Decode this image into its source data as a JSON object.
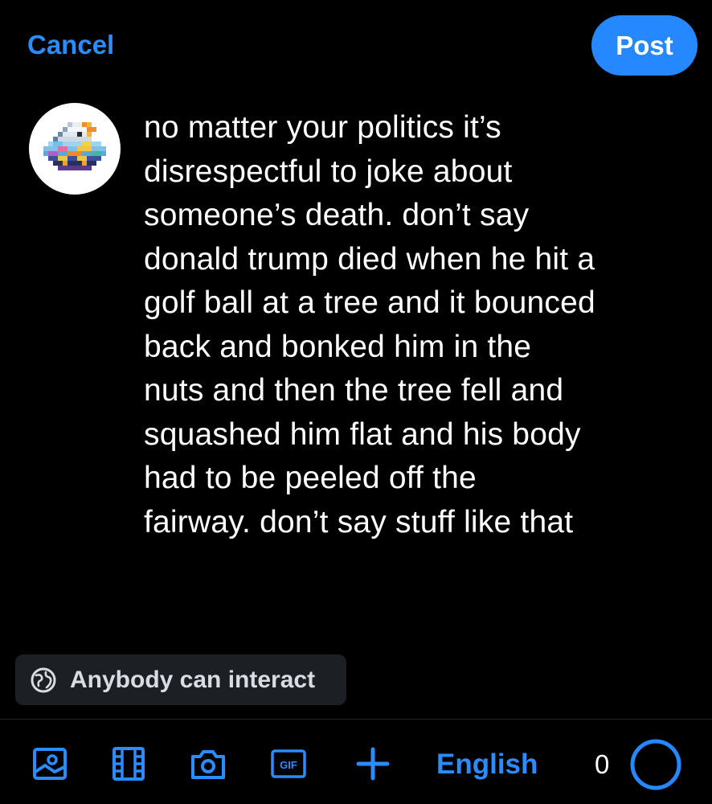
{
  "header": {
    "cancel_label": "Cancel",
    "post_label": "Post"
  },
  "composer": {
    "avatar_icon": "pixel-art-avatar",
    "text": "no matter your politics it’s\ndisrespectful to joke about\nsomeone’s death. don’t say\ndonald trump died when he hit a\ngolf ball at a tree and it bounced\nback and bonked him in the\nnuts and then the tree fell and\nsquashed him flat and his body\nhad to be peeled off the\nfairway. don’t say stuff like that"
  },
  "interaction_setting": {
    "icon": "globe-icon",
    "label": "Anybody can interact"
  },
  "toolbar": {
    "icons": [
      "image-icon",
      "video-icon",
      "camera-icon",
      "gif-icon",
      "plus-icon"
    ],
    "gif_text": "GIF",
    "language": "English",
    "char_count": "0",
    "progress": 0
  },
  "colors": {
    "accent": "#2688ff",
    "background": "#000000",
    "pill_background": "#1c1f24"
  }
}
